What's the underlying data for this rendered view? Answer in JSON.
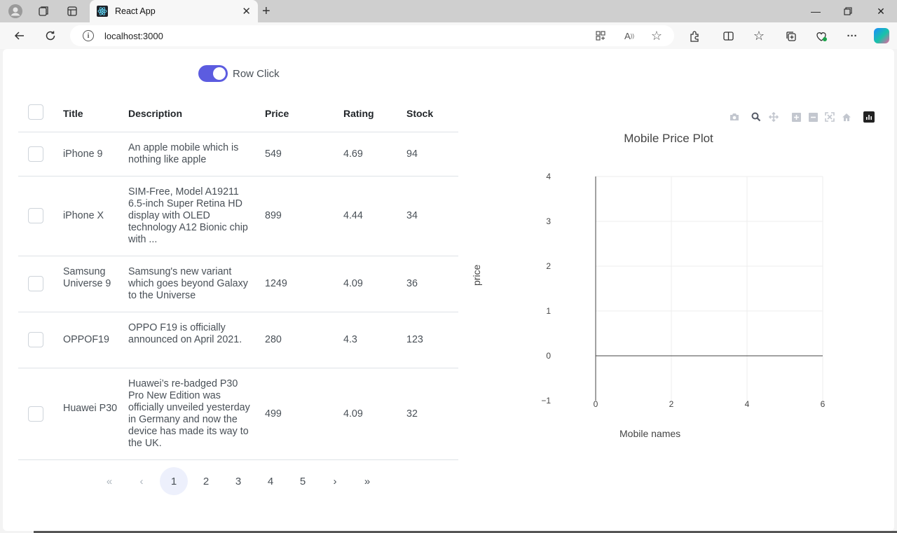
{
  "browser": {
    "tab_title": "React App",
    "url": "localhost:3000"
  },
  "toggle": {
    "label": "Row Click",
    "checked": true
  },
  "table": {
    "headers": [
      "Title",
      "Description",
      "Price",
      "Rating",
      "Stock"
    ],
    "rows": [
      {
        "title": "iPhone 9",
        "description": "An apple mobile which is nothing like apple",
        "price": "549",
        "rating": "4.69",
        "stock": "94"
      },
      {
        "title": "iPhone X",
        "description": "SIM-Free, Model A19211 6.5-inch Super Retina HD display with OLED technology A12 Bionic chip with ...",
        "price": "899",
        "rating": "4.44",
        "stock": "34"
      },
      {
        "title": "Samsung Universe 9",
        "description": "Samsung's new variant which goes beyond Galaxy to the Universe",
        "price": "1249",
        "rating": "4.09",
        "stock": "36"
      },
      {
        "title": "OPPOF19",
        "description": "OPPO F19 is officially announced on April 2021.",
        "price": "280",
        "rating": "4.3",
        "stock": "123"
      },
      {
        "title": "Huawei P30",
        "description": "Huawei’s re-badged P30 Pro New Edition was officially unveiled yesterday in Germany and now the device has made its way to the UK.",
        "price": "499",
        "rating": "4.09",
        "stock": "32"
      }
    ]
  },
  "pagination": {
    "first": "«",
    "prev": "‹",
    "next": "›",
    "last": "»",
    "pages": [
      "1",
      "2",
      "3",
      "4",
      "5"
    ],
    "current": "1"
  },
  "chart_data": {
    "type": "line",
    "title": "Mobile Price Plot",
    "xlabel": "Mobile names",
    "ylabel": "price",
    "xlim": [
      -1,
      6
    ],
    "ylim": [
      -1,
      4
    ],
    "x_ticks": [
      "0",
      "2",
      "4",
      "6"
    ],
    "y_ticks": [
      "−1",
      "0",
      "1",
      "2",
      "3",
      "4"
    ],
    "series": [],
    "grid": true
  },
  "modebar": [
    "camera-icon",
    "zoom-icon",
    "pan-icon",
    "zoom-in-icon",
    "zoom-out-icon",
    "autoscale-icon",
    "home-icon",
    "plotly-logo-icon"
  ]
}
